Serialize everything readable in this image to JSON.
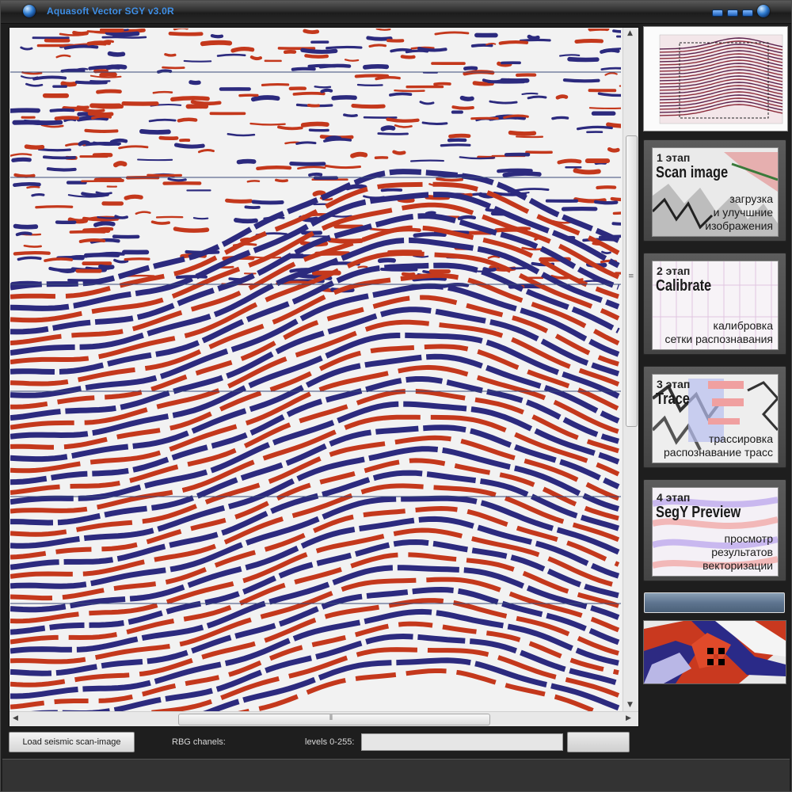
{
  "window": {
    "title": "Aquasoft Vector SGY v3.0R"
  },
  "colors": {
    "trough": "#2c2a7e",
    "peak": "#c4381c",
    "background": "#f2f2f2",
    "title_text": "#3f8fe6"
  },
  "stages": [
    {
      "number": "1 этап",
      "title": "Scan image",
      "desc": [
        "загрузка",
        "и улучшние",
        "изображения"
      ]
    },
    {
      "number": "2 этап",
      "title": "Calibrate",
      "desc": [
        "калибровка",
        "сетки распознавания"
      ]
    },
    {
      "number": "3 этап",
      "title": "Trace",
      "desc": [
        "трассировка",
        "распознавание трасс"
      ]
    },
    {
      "number": "4 этап",
      "title": "SegY Preview",
      "desc": [
        "просмотр",
        "результатов",
        "векторизации"
      ]
    }
  ],
  "bottom": {
    "load_button": "Load seismic scan-image",
    "rgb_label": "RBG chanels:",
    "levels_label": "levels 0-255:",
    "levels_value": ""
  },
  "icons": {
    "app": "blue-orb-icon",
    "minimize": "minimize-icon",
    "maximize": "maximize-icon",
    "close": "close-icon",
    "cursor": "crosshair-cursor-icon"
  }
}
